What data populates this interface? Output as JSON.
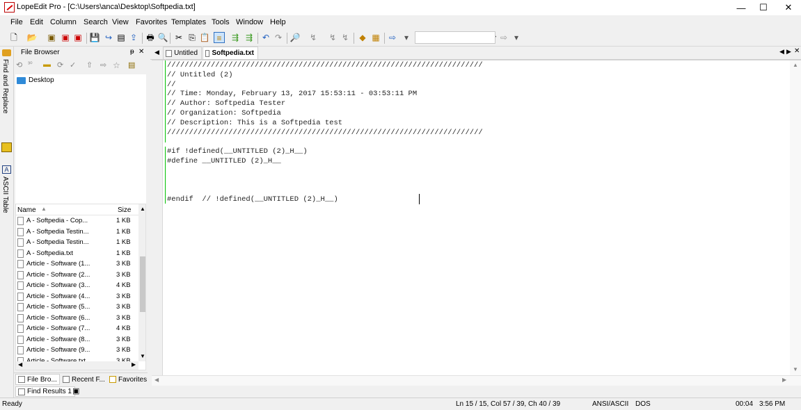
{
  "window": {
    "title": "LopeEdit Pro - [C:\\Users\\anca\\Desktop\\Softpedia.txt]",
    "minimize": "—",
    "maximize": "☐",
    "close": "✕"
  },
  "menu": [
    "File",
    "Edit",
    "Column",
    "Search",
    "View",
    "Favorites",
    "Templates",
    "Tools",
    "Window",
    "Help"
  ],
  "side_tabs": {
    "find_replace": "Find and Replace",
    "ascii_table": "ASCII Table"
  },
  "file_browser": {
    "title": "File Browser",
    "pin": "ᵽ",
    "close": "✕",
    "tree_root": "Desktop",
    "columns": {
      "name": "Name",
      "size": "Size"
    },
    "files": [
      {
        "name": "A - Softpedia - Cop...",
        "size": "1 KB"
      },
      {
        "name": "A - Softpedia Testin...",
        "size": "1 KB"
      },
      {
        "name": "A - Softpedia Testin...",
        "size": "1 KB"
      },
      {
        "name": "A - Softpedia.txt",
        "size": "1 KB"
      },
      {
        "name": "Article - Software (1...",
        "size": "3 KB"
      },
      {
        "name": "Article - Software (2...",
        "size": "3 KB"
      },
      {
        "name": "Article - Software (3...",
        "size": "4 KB"
      },
      {
        "name": "Article - Software (4...",
        "size": "3 KB"
      },
      {
        "name": "Article - Software (5...",
        "size": "3 KB"
      },
      {
        "name": "Article - Software (6...",
        "size": "3 KB"
      },
      {
        "name": "Article - Software (7...",
        "size": "4 KB"
      },
      {
        "name": "Article - Software (8...",
        "size": "3 KB"
      },
      {
        "name": "Article - Software (9...",
        "size": "3 KB"
      },
      {
        "name": "Article - Software.txt",
        "size": "3 KB"
      }
    ],
    "bottom_tabs": [
      "File Bro...",
      "Recent F...",
      "Favorites"
    ]
  },
  "editor_tabs": [
    {
      "label": "Untitled"
    },
    {
      "label": "Softpedia.txt"
    }
  ],
  "code_lines": [
    "////////////////////////////////////////////////////////////////////////",
    "// Untitled (2)",
    "//",
    "// Time: Monday, February 13, 2017 15:53:11 - 03:53:11 PM",
    "// Author: Softpedia Tester",
    "// Organization: Softpedia",
    "// Description: This is a Softpedia test",
    "////////////////////////////////////////////////////////////////////////",
    "",
    "#if !defined(__UNTITLED (2)_H__)",
    "#define __UNTITLED (2)_H__",
    "",
    "",
    "",
    "#endif  // !defined(__UNTITLED (2)_H__)"
  ],
  "find_results": "Find Results 1",
  "status": {
    "ready": "Ready",
    "position": "Ln 15 / 15, Col 57 / 39, Ch 40 / 39",
    "encoding": "ANSI/ASCII",
    "line_endings": "DOS",
    "elapsed": "00:04",
    "time": "3:56 PM"
  }
}
